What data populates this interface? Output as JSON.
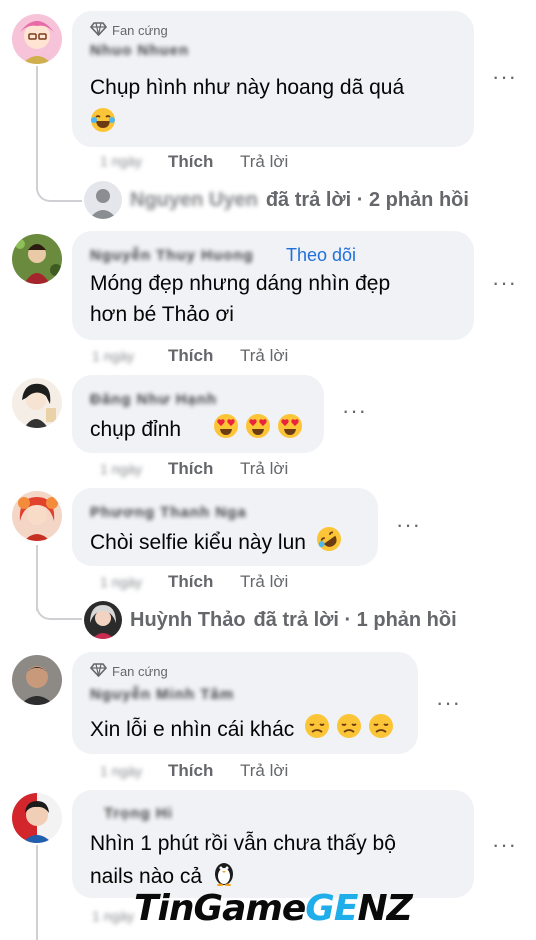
{
  "comments": [
    {
      "badge": "Fan cứng",
      "author": "Nhuo Nhuen",
      "text_lines": [
        "Chụp hình như này hoang dã quá"
      ],
      "time": "1 ngày",
      "like_label": "Thích",
      "reply_label": "Trả lời",
      "replies_summary": {
        "who": "Nguyen Uyen",
        "label": "đã trả lời · 2 phản hồi"
      }
    },
    {
      "author": "Nguyễn Thuy Huong",
      "follow_label": "Theo dõi",
      "text_lines": [
        "Móng đẹp nhưng dáng nhìn đẹp",
        "hơn bé Thảo ơi"
      ],
      "time": "1 ngày",
      "like_label": "Thích",
      "reply_label": "Trả lời"
    },
    {
      "author": "Đăng Như Hạnh",
      "text_lines": [
        "chụp đỉnh"
      ],
      "time": "1 ngày",
      "like_label": "Thích",
      "reply_label": "Trả lời"
    },
    {
      "author": "Phương Thanh Nga",
      "text_lines": [
        "Chòi selfie kiểu này lun"
      ],
      "time": "1 ngày",
      "like_label": "Thích",
      "reply_label": "Trả lời",
      "replies_summary": {
        "who": "Huỳnh Thảo",
        "label": "đã trả lời · 1 phản hồi"
      }
    },
    {
      "badge": "Fan cứng",
      "author": "Nguyễn Minh Tâm",
      "text_lines": [
        "Xin lỗi e nhìn cái khác"
      ],
      "time": "1 ngày",
      "like_label": "Thích",
      "reply_label": "Trả lời"
    },
    {
      "author": "Trọng Hi",
      "text_lines": [
        "Nhìn 1 phút rồi vẫn chưa thấy bộ",
        "nails nào cả"
      ],
      "time": "1 ngày"
    }
  ],
  "more_label": "···",
  "watermark": {
    "part1": "TinGame",
    "part2": "GE",
    "part3": "NZ"
  },
  "icons": {
    "badge": "diamond-icon",
    "more": "more-horizontal-icon",
    "laugh": "laughing-tears-emoji",
    "heart_eyes": "heart-eyes-emoji",
    "rofl": "rolling-laughing-emoji",
    "sad": "disappointed-emoji",
    "penguin": "penguin-emoji"
  },
  "colors": {
    "bubble": "#f0f2f5",
    "link": "#216fdb",
    "muted": "#65676b"
  }
}
